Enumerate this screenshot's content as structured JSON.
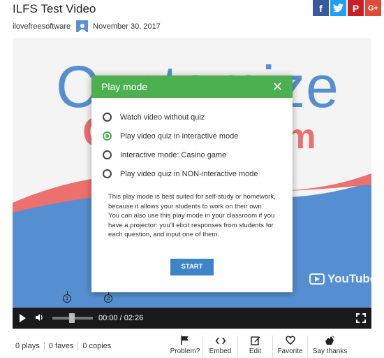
{
  "video": {
    "title": "ILFS Test Video",
    "author": "ilovefreesoftware",
    "date": "November 30, 2017"
  },
  "share": {
    "facebook": "f",
    "twitter": "t",
    "pinterest": "P",
    "google": "G+"
  },
  "background": {
    "headline": "Customize",
    "red_left": "Q",
    "red_right": "m",
    "brand": "YouTube"
  },
  "markers": [
    "1",
    "2"
  ],
  "player": {
    "time": "00:00 / 02:26",
    "progress": 0.0,
    "volume_icon": "speaker-icon"
  },
  "modal": {
    "title": "Play mode",
    "close": "✕",
    "options": [
      {
        "label": "Watch video without quiz",
        "selected": false
      },
      {
        "label": "Play video quiz in interactive mode",
        "selected": true
      },
      {
        "label": "Interactive mode: Casino game",
        "selected": false
      },
      {
        "label": "Play video quiz in NON-interactive mode",
        "selected": false
      }
    ],
    "description": "This play mode is best suited for self-study or homework, because it allows your students to work on their own. You can also use this play mode in your classroom if you have a projector: you'll elicit responses from students for each question, and input one of them.",
    "start": "START"
  },
  "stats": {
    "plays": "0 plays",
    "faves": "0 faves",
    "copies": "0 copies"
  },
  "actions": {
    "problem": "Problem?",
    "embed": "Embed",
    "edit": "Edit",
    "favorite": "Favorite",
    "thanks": "Say thanks"
  },
  "colors": {
    "header_green": "#4caf50",
    "start_blue": "#3d84c8",
    "brand_blue": "#1565c0"
  }
}
